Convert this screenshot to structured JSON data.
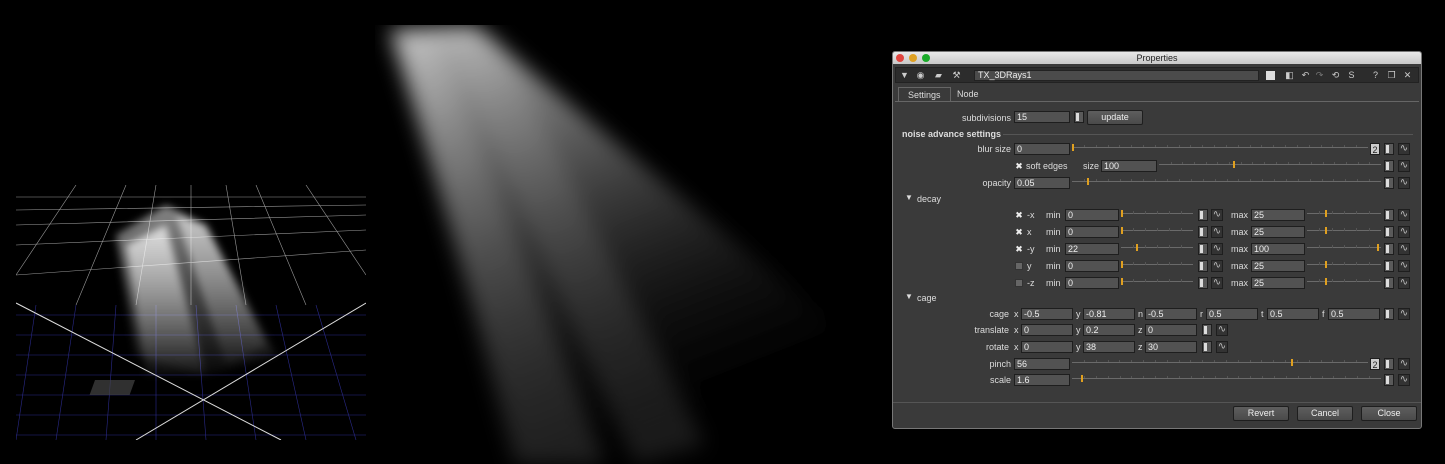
{
  "window": {
    "title": "Properties"
  },
  "toolbar": {
    "node_name": "TX_3DRays1",
    "help_label": "?",
    "float_label": "❐",
    "close_label": "✕",
    "s_label": "S"
  },
  "tabs": [
    {
      "label": "Settings"
    },
    {
      "label": "Node"
    }
  ],
  "settings": {
    "subdivisions": {
      "label": "subdivisions",
      "value": "15",
      "button": "update"
    },
    "noise_header": "noise advance settings",
    "blur_size": {
      "label": "blur size",
      "value": "0",
      "channels": "2"
    },
    "soft_edges": {
      "label": "soft edges",
      "checked": true,
      "size_label": "size",
      "size_value": "100"
    },
    "opacity": {
      "label": "opacity",
      "value": "0.05"
    },
    "decay": {
      "label": "decay",
      "rows": [
        {
          "axis": "-x",
          "checked": true,
          "min_label": "min",
          "min": "0",
          "max_label": "max",
          "max": "25",
          "min_frac": 0.0,
          "max_frac": 0.25
        },
        {
          "axis": "x",
          "checked": true,
          "min_label": "min",
          "min": "0",
          "max_label": "max",
          "max": "25",
          "min_frac": 0.0,
          "max_frac": 0.25
        },
        {
          "axis": "-y",
          "checked": true,
          "min_label": "min",
          "min": "22",
          "max_label": "max",
          "max": "100",
          "min_frac": 0.22,
          "max_frac": 1.0
        },
        {
          "axis": "y",
          "checked": false,
          "min_label": "min",
          "min": "0",
          "max_label": "max",
          "max": "25",
          "min_frac": 0.0,
          "max_frac": 0.25
        },
        {
          "axis": "-z",
          "checked": false,
          "min_label": "min",
          "min": "0",
          "max_label": "max",
          "max": "25",
          "min_frac": 0.0,
          "max_frac": 0.25
        }
      ]
    },
    "cage_section": "cage",
    "cage": {
      "label": "cage",
      "x_label": "x",
      "x": "-0.5",
      "y_label": "y",
      "y": "-0.81",
      "n_label": "n",
      "n": "-0.5",
      "r_label": "r",
      "r": "0.5",
      "t_label": "t",
      "t": "0.5",
      "f_label": "f",
      "f": "0.5"
    },
    "translate": {
      "label": "translate",
      "x_label": "x",
      "x": "0",
      "y_label": "y",
      "y": "0.2",
      "z_label": "z",
      "z": "0"
    },
    "rotate": {
      "label": "rotate",
      "x_label": "x",
      "x": "0",
      "y_label": "y",
      "y": "38",
      "z_label": "z",
      "z": "30"
    },
    "pinch": {
      "label": "pinch",
      "value": "56",
      "channels": "2"
    },
    "scale": {
      "label": "scale",
      "value": "1.6"
    }
  },
  "buttons": {
    "revert": "Revert",
    "cancel": "Cancel",
    "close": "Close"
  },
  "colors": {
    "panel": "#3a3a3a",
    "field": "#525252",
    "slider_thumb": "#e0a020",
    "grid_floor": "#2a2a8a"
  }
}
